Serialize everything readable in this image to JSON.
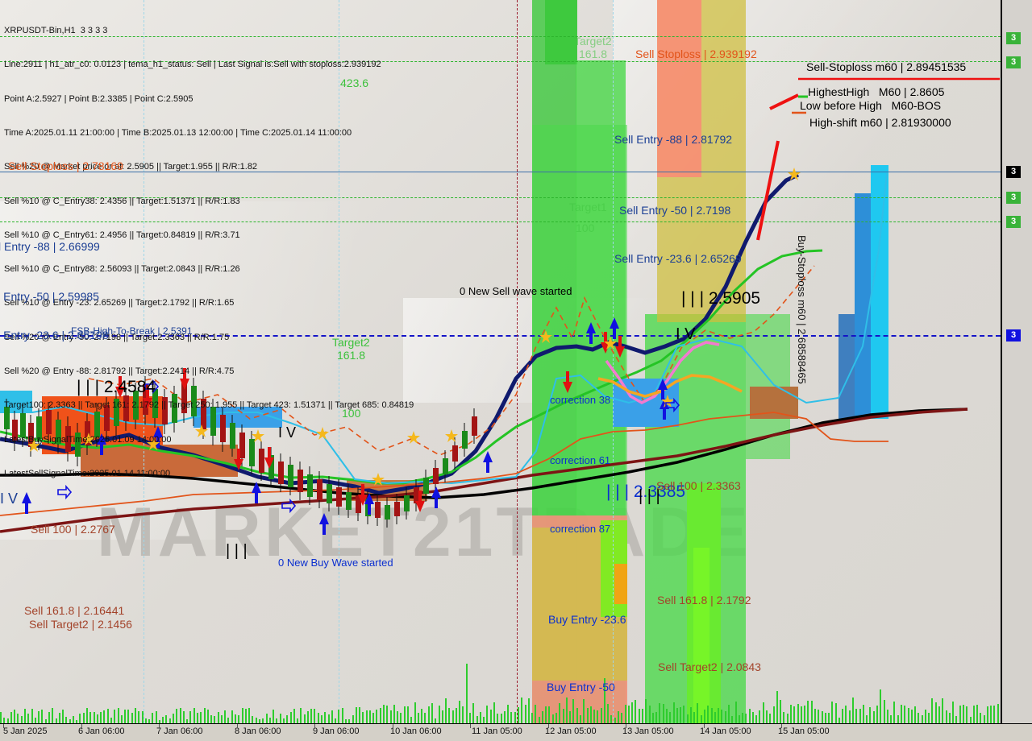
{
  "chart_data": {
    "type": "line",
    "title": "XRPUSDT-Bin,H1  3 3 3 3",
    "symbol": "XRPUSDT-Bin",
    "timeframe": "H1",
    "xlabel": "",
    "ylabel": "",
    "x_tick_labels": [
      "5 Jan 2025",
      "6 Jan 06:00",
      "7 Jan 06:00",
      "8 Jan 06:00",
      "9 Jan 06:00",
      "10 Jan 06:00",
      "11 Jan 05:00",
      "12 Jan 05:00",
      "13 Jan 05:00",
      "14 Jan 05:00",
      "15 Jan 05:00"
    ],
    "ylim": [
      2.02,
      2.97
    ],
    "grid": false,
    "legend": "none",
    "price_levels": [
      {
        "name": "Sell-Stoploss m60",
        "value": 2.89451535
      },
      {
        "name": "HighestHigh M60",
        "value": 2.8605
      },
      {
        "name": "High-shift m60",
        "value": 2.8193
      },
      {
        "name": "Sell Stoploss",
        "value": 2.939192
      },
      {
        "name": "Sell Entry -88",
        "value": 2.81792
      },
      {
        "name": "Sell Stoploss left",
        "value": 2.78169
      },
      {
        "name": "Sell Entry -50",
        "value": 2.7198
      },
      {
        "name": "Buy-Stoploss m60",
        "value": 2.68588465
      },
      {
        "name": "Sell Entry -23.6",
        "value": 2.65269
      },
      {
        "name": "Entry -88 left",
        "value": 2.66999
      },
      {
        "name": "Entry -50 left",
        "value": 2.59985
      },
      {
        "name": "Point C",
        "value": 2.5905
      },
      {
        "name": "FSB-High-To-Break",
        "value": 2.5391
      },
      {
        "name": "Mid label",
        "value": 2.4584
      },
      {
        "name": "Point B",
        "value": 2.3385
      },
      {
        "name": "Sell 100",
        "value": 2.3363
      },
      {
        "name": "Sell 100 left",
        "value": 2.2767
      },
      {
        "name": "Sell 161.8",
        "value": 2.1792
      },
      {
        "name": "Sell 161.8 left",
        "value": 2.16441
      },
      {
        "name": "Sell Target2 left",
        "value": 2.1456
      },
      {
        "name": "Sell Target2",
        "value": 2.0843
      }
    ]
  },
  "header": {
    "line1": "XRPUSDT-Bin,H1  3 3 3 3",
    "line2": "Line:2911 | h1_atr_c0: 0.0123 | tema_h1_status: Sell | Last Signal is:Sell with stoploss:2.939192",
    "line3": "Point A:2.5927 | Point B:2.3385 | Point C:2.5905",
    "line4": "Time A:2025.01.11 21:00:00 | Time B:2025.01.13 12:00:00 | Time C:2025.01.14 11:00:00",
    "line5": "Sell %20 @ Market price or at: 2.5905 || Target:1.955 || R/R:1.82",
    "line6": "Sell %10 @ C_Entry38: 2.4356 || Target:1.51371 || R/R:1.83",
    "line7": "Sell %10 @ C_Entry61: 2.4956 || Target:0.84819 || R/R:3.71",
    "line8": "Sell %10 @ C_Entry88: 2.56093 || Target:2.0843 || R/R:1.26",
    "line9": "Sell %10 @ Entry -23: 2.65269 || Target:2.1792 || R/R:1.65",
    "line10": "Sell %20 @ Entry -50: 2.7198 || Target:2.3363 || R/R:1.75",
    "line11": "Sell %20 @ Entry -88: 2.81792 || Target:2.2414 || R/R:4.75",
    "line12": "Target100: 2.3363 || Target 161: 2.1792 || Target 250: 1.955 || Target 423: 1.51371 || Target 685: 0.84819",
    "line13": "LatestBuySignalTime:2025.01.09 14:00:00",
    "line14": "LatestSellSignalTime:2025.01.14 11:00:00"
  },
  "annotations": {
    "fib_423": "423.6",
    "target2_top": "Target2",
    "target2_top_sub": "161.8",
    "target1_mid": "Target1",
    "target1_mid_sub": "100",
    "target2_left": "Target2",
    "target2_left_sub": "161.8",
    "fib100_left": "100",
    "sell_stoploss_top": "Sell Stoploss | 2.939192",
    "sell_stoploss_m60": "Sell-Stoploss m60 | 2.89451535",
    "highest_high_m60": "HighestHigh   M60 | 2.8605",
    "low_before_high": "Low before High   M60-BOS",
    "high_shift_m60": "High-shift m60 | 2.81930000",
    "sell_entry_88": "Sell Entry -88 | 2.81792",
    "sell_stoploss_left": "Sell Stoploss | 2.78169",
    "sell_entry_50": "Sell Entry -50 | 2.7198",
    "sell_entry_236": "Sell Entry -23.6 | 2.65269",
    "buy_stoploss_m60": "Buy-Stoploss m60 | 2.68588465",
    "entry_88_left": "l Entry -88 | 2.66999",
    "entry_50_left": "ll Entry -50 | 2.59985",
    "entry_236_left": "ll Entry -23.6 | 2.65198",
    "fsb_high_to_break": "FSB-High-To-Break | 2.5391",
    "point_c_mid": "| | | 2.5905",
    "iv_mid": "I V",
    "iii_left": "| | | 2.4584",
    "iv_left": "I V",
    "iii_low": "| | |",
    "iv_low_left": "I V",
    "new_sell_wave": "0 New Sell wave started",
    "new_buy_wave": "0 New Buy Wave started",
    "correction_38": "correction 38",
    "correction_61": "correction 61",
    "correction_87": "correction 87",
    "point_b_mid": "| | | 2.3385",
    "sell_100_mid": "Sell 100 | 2.3363",
    "sell_100_left": "Sell 100 | 2.2767",
    "sell_1618_mid": "Sell 161.8 | 2.1792",
    "sell_1618_left": "Sell 161.8 | 2.16441",
    "sell_target2_left": "Sell Target2 | 2.1456",
    "sell_target2_mid": "Sell Target2 | 2.0843",
    "buy_entry_236": "Buy Entry -23.6",
    "buy_entry_50": "Buy Entry -50"
  },
  "scale_badges": [
    {
      "text": "3",
      "style": "green"
    },
    {
      "text": "3",
      "style": "green"
    },
    {
      "text": "3",
      "style": "black"
    },
    {
      "text": "3",
      "style": "green"
    },
    {
      "text": "3",
      "style": "green"
    },
    {
      "text": "3",
      "style": "blue"
    }
  ],
  "x_axis": {
    "labels": [
      "5 Jan 2025",
      "6 Jan 06:00",
      "7 Jan 06:00",
      "8 Jan 06:00",
      "9 Jan 06:00",
      "10 Jan 06:00",
      "11 Jan 05:00",
      "12 Jan 05:00",
      "13 Jan 05:00",
      "14 Jan 05:00",
      "15 Jan 05:00"
    ]
  },
  "colors": {
    "accent_green": "#3cc13c",
    "sell_orange": "#e2541a",
    "entry_blue": "#1c3f94",
    "target_brown": "#a3432a",
    "band_green": "#4cd14c",
    "band_red": "#ff8c80"
  }
}
